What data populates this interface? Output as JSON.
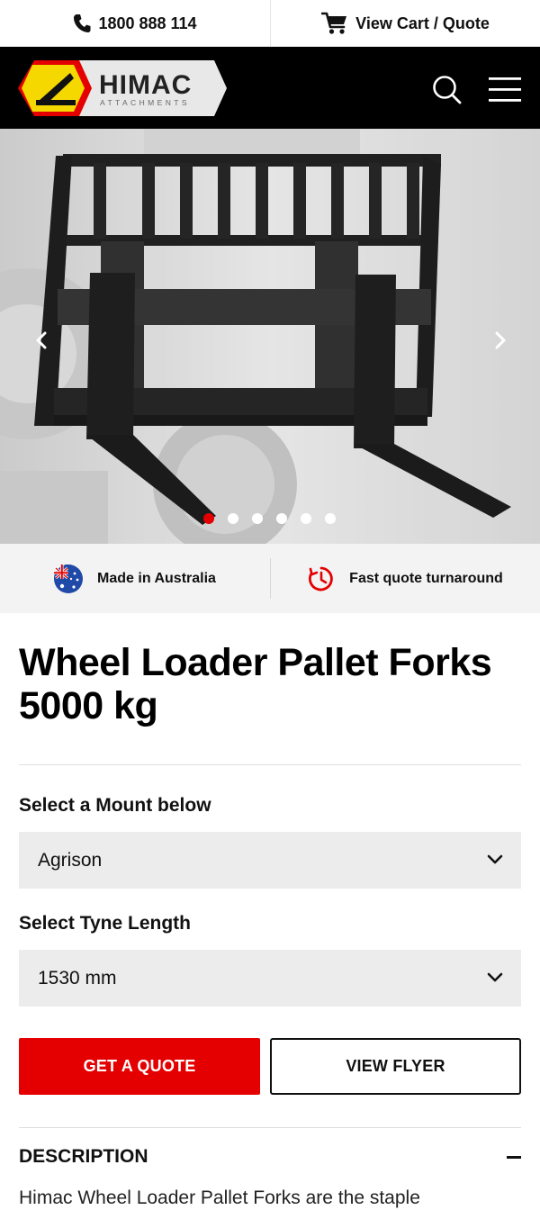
{
  "utility": {
    "phone": "1800 888 114",
    "cart": "View Cart / Quote"
  },
  "header": {
    "logo_text": "HIMAC",
    "logo_subtext": "ATTACHMENTS"
  },
  "hero": {
    "slide_count": 6,
    "active_slide": 1
  },
  "features": [
    {
      "label": "Made in Australia",
      "icon": "australia-flag-icon"
    },
    {
      "label": "Fast quote turnaround",
      "icon": "timer-icon"
    }
  ],
  "product": {
    "title_line1": "Wheel Loader Pallet Forks",
    "title_line2": "5000 kg",
    "mount_label": "Select a Mount below",
    "mount_value": "Agrison",
    "tyne_label": "Select Tyne Length",
    "tyne_value": "1530 mm",
    "quote_button": "GET A QUOTE",
    "flyer_button": "VIEW FLYER",
    "description_heading": "DESCRIPTION",
    "description_text": "Himac Wheel Loader Pallet Forks are the staple"
  },
  "colors": {
    "accent": "#e40000",
    "header_bg": "#000000",
    "logo_yellow": "#f5d800"
  }
}
